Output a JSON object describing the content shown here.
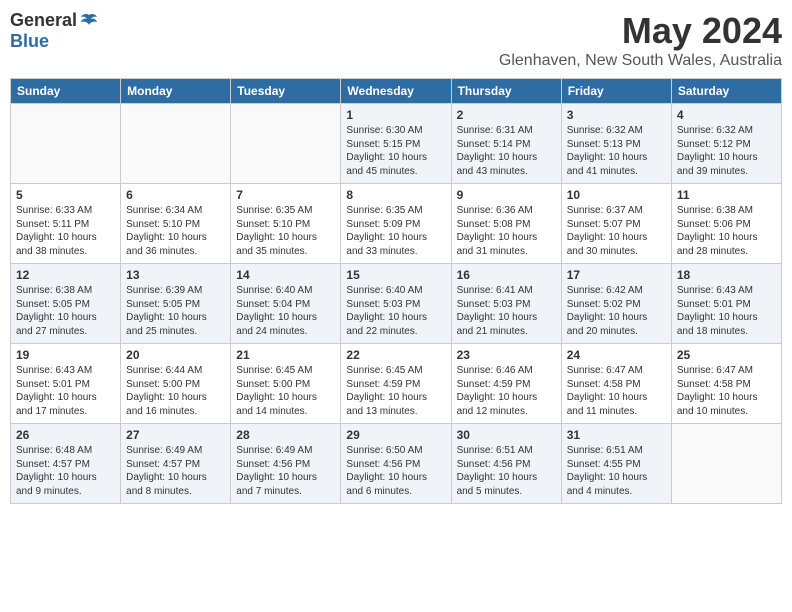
{
  "header": {
    "logo_general": "General",
    "logo_blue": "Blue",
    "month_title": "May 2024",
    "location": "Glenhaven, New South Wales, Australia"
  },
  "weekdays": [
    "Sunday",
    "Monday",
    "Tuesday",
    "Wednesday",
    "Thursday",
    "Friday",
    "Saturday"
  ],
  "weeks": [
    [
      {
        "day": "",
        "info": ""
      },
      {
        "day": "",
        "info": ""
      },
      {
        "day": "",
        "info": ""
      },
      {
        "day": "1",
        "info": "Sunrise: 6:30 AM\nSunset: 5:15 PM\nDaylight: 10 hours\nand 45 minutes."
      },
      {
        "day": "2",
        "info": "Sunrise: 6:31 AM\nSunset: 5:14 PM\nDaylight: 10 hours\nand 43 minutes."
      },
      {
        "day": "3",
        "info": "Sunrise: 6:32 AM\nSunset: 5:13 PM\nDaylight: 10 hours\nand 41 minutes."
      },
      {
        "day": "4",
        "info": "Sunrise: 6:32 AM\nSunset: 5:12 PM\nDaylight: 10 hours\nand 39 minutes."
      }
    ],
    [
      {
        "day": "5",
        "info": "Sunrise: 6:33 AM\nSunset: 5:11 PM\nDaylight: 10 hours\nand 38 minutes."
      },
      {
        "day": "6",
        "info": "Sunrise: 6:34 AM\nSunset: 5:10 PM\nDaylight: 10 hours\nand 36 minutes."
      },
      {
        "day": "7",
        "info": "Sunrise: 6:35 AM\nSunset: 5:10 PM\nDaylight: 10 hours\nand 35 minutes."
      },
      {
        "day": "8",
        "info": "Sunrise: 6:35 AM\nSunset: 5:09 PM\nDaylight: 10 hours\nand 33 minutes."
      },
      {
        "day": "9",
        "info": "Sunrise: 6:36 AM\nSunset: 5:08 PM\nDaylight: 10 hours\nand 31 minutes."
      },
      {
        "day": "10",
        "info": "Sunrise: 6:37 AM\nSunset: 5:07 PM\nDaylight: 10 hours\nand 30 minutes."
      },
      {
        "day": "11",
        "info": "Sunrise: 6:38 AM\nSunset: 5:06 PM\nDaylight: 10 hours\nand 28 minutes."
      }
    ],
    [
      {
        "day": "12",
        "info": "Sunrise: 6:38 AM\nSunset: 5:05 PM\nDaylight: 10 hours\nand 27 minutes."
      },
      {
        "day": "13",
        "info": "Sunrise: 6:39 AM\nSunset: 5:05 PM\nDaylight: 10 hours\nand 25 minutes."
      },
      {
        "day": "14",
        "info": "Sunrise: 6:40 AM\nSunset: 5:04 PM\nDaylight: 10 hours\nand 24 minutes."
      },
      {
        "day": "15",
        "info": "Sunrise: 6:40 AM\nSunset: 5:03 PM\nDaylight: 10 hours\nand 22 minutes."
      },
      {
        "day": "16",
        "info": "Sunrise: 6:41 AM\nSunset: 5:03 PM\nDaylight: 10 hours\nand 21 minutes."
      },
      {
        "day": "17",
        "info": "Sunrise: 6:42 AM\nSunset: 5:02 PM\nDaylight: 10 hours\nand 20 minutes."
      },
      {
        "day": "18",
        "info": "Sunrise: 6:43 AM\nSunset: 5:01 PM\nDaylight: 10 hours\nand 18 minutes."
      }
    ],
    [
      {
        "day": "19",
        "info": "Sunrise: 6:43 AM\nSunset: 5:01 PM\nDaylight: 10 hours\nand 17 minutes."
      },
      {
        "day": "20",
        "info": "Sunrise: 6:44 AM\nSunset: 5:00 PM\nDaylight: 10 hours\nand 16 minutes."
      },
      {
        "day": "21",
        "info": "Sunrise: 6:45 AM\nSunset: 5:00 PM\nDaylight: 10 hours\nand 14 minutes."
      },
      {
        "day": "22",
        "info": "Sunrise: 6:45 AM\nSunset: 4:59 PM\nDaylight: 10 hours\nand 13 minutes."
      },
      {
        "day": "23",
        "info": "Sunrise: 6:46 AM\nSunset: 4:59 PM\nDaylight: 10 hours\nand 12 minutes."
      },
      {
        "day": "24",
        "info": "Sunrise: 6:47 AM\nSunset: 4:58 PM\nDaylight: 10 hours\nand 11 minutes."
      },
      {
        "day": "25",
        "info": "Sunrise: 6:47 AM\nSunset: 4:58 PM\nDaylight: 10 hours\nand 10 minutes."
      }
    ],
    [
      {
        "day": "26",
        "info": "Sunrise: 6:48 AM\nSunset: 4:57 PM\nDaylight: 10 hours\nand 9 minutes."
      },
      {
        "day": "27",
        "info": "Sunrise: 6:49 AM\nSunset: 4:57 PM\nDaylight: 10 hours\nand 8 minutes."
      },
      {
        "day": "28",
        "info": "Sunrise: 6:49 AM\nSunset: 4:56 PM\nDaylight: 10 hours\nand 7 minutes."
      },
      {
        "day": "29",
        "info": "Sunrise: 6:50 AM\nSunset: 4:56 PM\nDaylight: 10 hours\nand 6 minutes."
      },
      {
        "day": "30",
        "info": "Sunrise: 6:51 AM\nSunset: 4:56 PM\nDaylight: 10 hours\nand 5 minutes."
      },
      {
        "day": "31",
        "info": "Sunrise: 6:51 AM\nSunset: 4:55 PM\nDaylight: 10 hours\nand 4 minutes."
      },
      {
        "day": "",
        "info": ""
      }
    ]
  ]
}
